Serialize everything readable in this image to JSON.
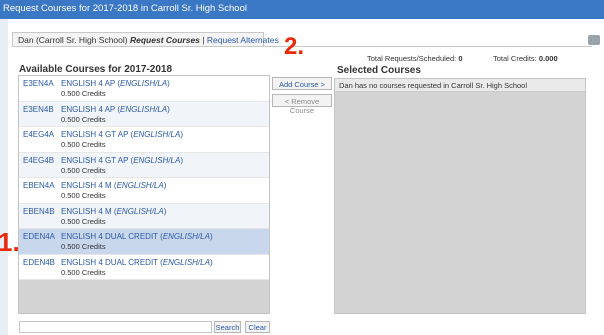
{
  "window": {
    "title": "Request Courses for 2017-2018 in Carroll Sr. High School"
  },
  "tabs": {
    "student": "Dan (Carroll Sr. High School)",
    "request_courses": "Request Courses",
    "separator": "|",
    "request_alternates": "Request Alternates"
  },
  "summary": {
    "requests_label": "Total Requests/Scheduled:",
    "requests_value": "0",
    "credits_label": "Total Credits:",
    "credits_value": "0.000"
  },
  "available": {
    "heading": "Available Courses for 2017-2018",
    "courses": [
      {
        "code": "E3EN4A",
        "name": "ENGLISH 4 AP",
        "dept": "ENGLISH/LA",
        "credits": "0.500 Credits"
      },
      {
        "code": "E3EN4B",
        "name": "ENGLISH 4 AP",
        "dept": "ENGLISH/LA",
        "credits": "0.500 Credits"
      },
      {
        "code": "E4EG4A",
        "name": "ENGLISH 4 GT AP",
        "dept": "ENGLISH/LA",
        "credits": "0.500 Credits"
      },
      {
        "code": "E4EG4B",
        "name": "ENGLISH 4 GT AP",
        "dept": "ENGLISH/LA",
        "credits": "0.500 Credits"
      },
      {
        "code": "EBEN4A",
        "name": "ENGLISH 4 M",
        "dept": "ENGLISH/LA",
        "credits": "0.500 Credits"
      },
      {
        "code": "EBEN4B",
        "name": "ENGLISH 4 M",
        "dept": "ENGLISH/LA",
        "credits": "0.500 Credits"
      },
      {
        "code": "EDEN4A",
        "name": "ENGLISH 4 DUAL CREDIT",
        "dept": "ENGLISH/LA",
        "credits": "0.500 Credits"
      },
      {
        "code": "EDEN4B",
        "name": "ENGLISH 4 DUAL CREDIT",
        "dept": "ENGLISH/LA",
        "credits": "0.500 Credits"
      }
    ]
  },
  "actions": {
    "add": "Add Course >",
    "remove": "< Remove Course"
  },
  "selected": {
    "heading": "Selected Courses",
    "empty_message": "Dan has no courses requested in Carroll Sr. High School"
  },
  "search": {
    "value": "",
    "search_label": "Search",
    "clear_label": "Clear"
  },
  "annotations": {
    "one": "1.",
    "two": "2."
  },
  "colors": {
    "titlebar": "#3a77c4",
    "link": "#2a59a8",
    "annotation": "#e8290b",
    "selected_row": "#c8d7ec"
  },
  "icons": {
    "print": "printer-icon"
  }
}
